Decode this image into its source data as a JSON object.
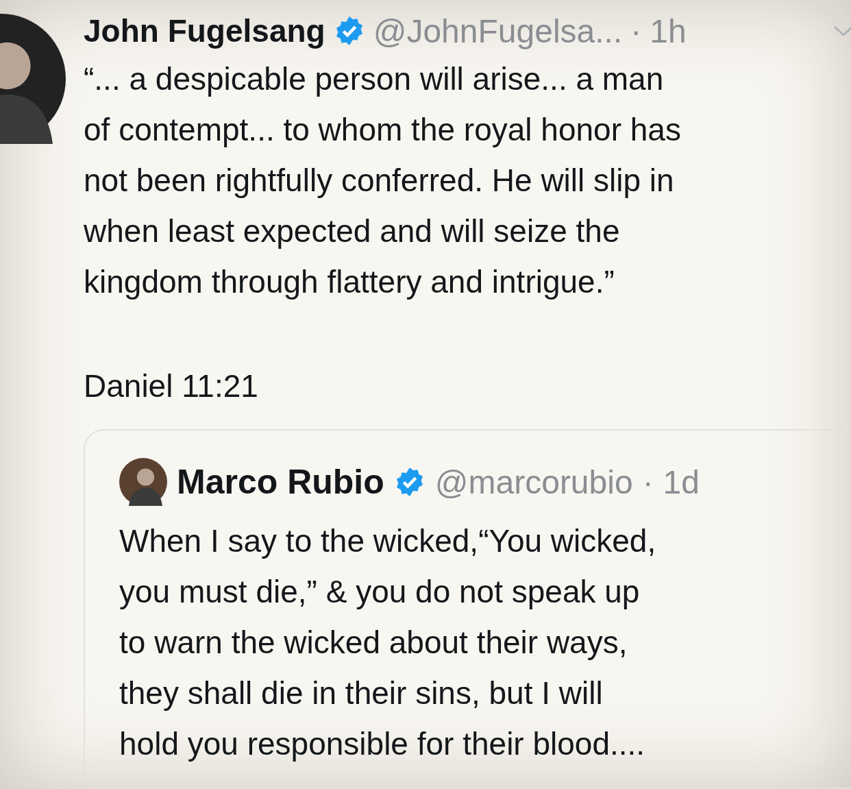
{
  "tweet": {
    "name": "John Fugelsang",
    "verified": true,
    "handle": "@JohnFugelsa...",
    "separator": "·",
    "time": "1h",
    "text_lines": [
      "“... a despicable person will arise... a man",
      "of contempt... to whom the royal honor has",
      "not been rightfully conferred. He will slip in",
      "when least expected and will seize the",
      "kingdom through flattery and intrigue.”"
    ],
    "citation": "Daniel 11:21",
    "quoted": {
      "name": "Marco Rubio",
      "verified": true,
      "handle": "@marcorubio",
      "separator": "·",
      "time": "1d",
      "text_lines": [
        "When I say to the wicked,“You wicked,",
        "you must die,” & you do not speak up",
        "to warn the wicked about their ways,",
        "they shall die in their sins, but I will",
        "hold you responsible for their blood...."
      ]
    }
  }
}
